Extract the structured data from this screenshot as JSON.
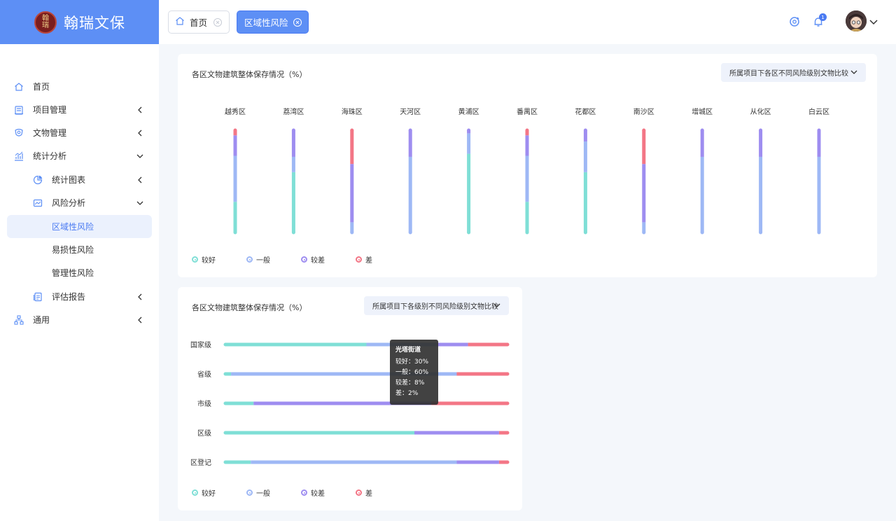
{
  "app": {
    "name": "翰瑞文保",
    "logo_text": "翰瑞"
  },
  "sidebar": {
    "items": [
      {
        "label": "首页",
        "icon": "home-icon"
      },
      {
        "label": "项目管理",
        "icon": "project-icon"
      },
      {
        "label": "文物管理",
        "icon": "relic-icon"
      },
      {
        "label": "统计分析",
        "icon": "stats-icon"
      },
      {
        "label": "统计图表",
        "icon": "pie-chart-icon"
      },
      {
        "label": "风险分析",
        "icon": "risk-icon"
      },
      {
        "label": "区域性风险",
        "icon": ""
      },
      {
        "label": "易损性风险",
        "icon": ""
      },
      {
        "label": "管理性风险",
        "icon": ""
      },
      {
        "label": "评估报告",
        "icon": "report-icon"
      },
      {
        "label": "通用",
        "icon": "general-icon"
      }
    ]
  },
  "tabs": [
    {
      "label": "首页",
      "active": false
    },
    {
      "label": "区域性风险",
      "active": true
    }
  ],
  "topbar": {
    "notification_count": "1"
  },
  "colors": {
    "good": "#7fdfd6",
    "normal": "#9eb8f5",
    "poor": "#9e8df0",
    "bad": "#f37686",
    "accent": "#5d8ff5"
  },
  "legend": [
    {
      "label": "较好",
      "color": "#7fdfd6"
    },
    {
      "label": "一般",
      "color": "#9eb8f5"
    },
    {
      "label": "较差",
      "color": "#9e8df0"
    },
    {
      "label": "差",
      "color": "#f37686"
    }
  ],
  "chart1": {
    "title": "各区文物建筑整体保存情况（%）",
    "dropdown": "所属项目下各区不同风险级别文物比较"
  },
  "chart2": {
    "title": "各区文物建筑整体保存情况（%）",
    "dropdown": "所属项目下各级别不同风险级别文物比较"
  },
  "tooltip": {
    "title": "光塔街道",
    "lines": [
      "较好：30%",
      "一般：60%",
      "较差：8%",
      "差：2%"
    ]
  },
  "chart_data": [
    {
      "type": "bar",
      "stacked": true,
      "orientation": "vertical",
      "title": "各区文物建筑整体保存情况（%）",
      "categories": [
        "越秀区",
        "荔湾区",
        "海珠区",
        "天河区",
        "黄浦区",
        "番禺区",
        "花都区",
        "南沙区",
        "增城区",
        "从化区",
        "白云区"
      ],
      "series": [
        {
          "name": "较好",
          "values": [
            30,
            59,
            0,
            0,
            77,
            30,
            59,
            0,
            0,
            0,
            0
          ]
        },
        {
          "name": "一般",
          "values": [
            45,
            15,
            10,
            74,
            20,
            45,
            30,
            10,
            74,
            74,
            74
          ]
        },
        {
          "name": "较差",
          "values": [
            20,
            26,
            57,
            26,
            3,
            20,
            11,
            57,
            26,
            26,
            26
          ]
        },
        {
          "name": "差",
          "values": [
            5,
            0,
            33,
            0,
            0,
            5,
            0,
            33,
            0,
            0,
            0
          ]
        }
      ],
      "ylim": [
        0,
        100
      ]
    },
    {
      "type": "bar",
      "stacked": true,
      "orientation": "horizontal",
      "title": "各区文物建筑整体保存情况（%）",
      "categories": [
        "国家级",
        "省级",
        "市级",
        "区级",
        "区登记"
      ],
      "series": [
        {
          "name": "较好",
          "values": [
            50,
            2,
            10,
            67,
            9
          ]
        },
        {
          "name": "一般",
          "values": [
            25,
            80,
            0,
            0,
            73
          ]
        },
        {
          "name": "较差",
          "values": [
            11,
            0,
            63,
            30,
            15
          ]
        },
        {
          "name": "差",
          "values": [
            14,
            18,
            27,
            3,
            3
          ]
        }
      ],
      "xlim": [
        0,
        100
      ]
    }
  ]
}
